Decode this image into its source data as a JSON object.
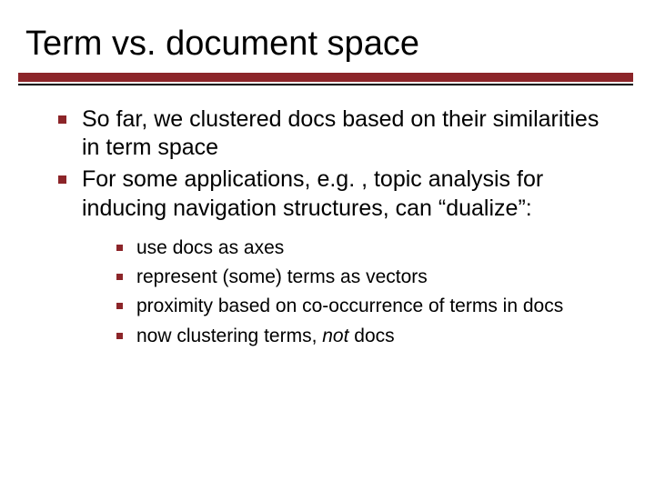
{
  "title": "Term vs. document space",
  "bullets": {
    "b0": "So far, we clustered docs based on their similarities in term space",
    "b1_pre": "For some applications, e.g. , topic analysis for inducing navigation structures, can “dualize”:",
    "sub": {
      "s0": "use docs as axes",
      "s1": "represent (some) terms as vectors",
      "s2": "proximity based on co-occurrence of terms in docs",
      "s3_pre": "now clustering terms, ",
      "s3_ital": "not",
      "s3_post": " docs"
    }
  },
  "colors": {
    "accent": "#8c2529"
  }
}
